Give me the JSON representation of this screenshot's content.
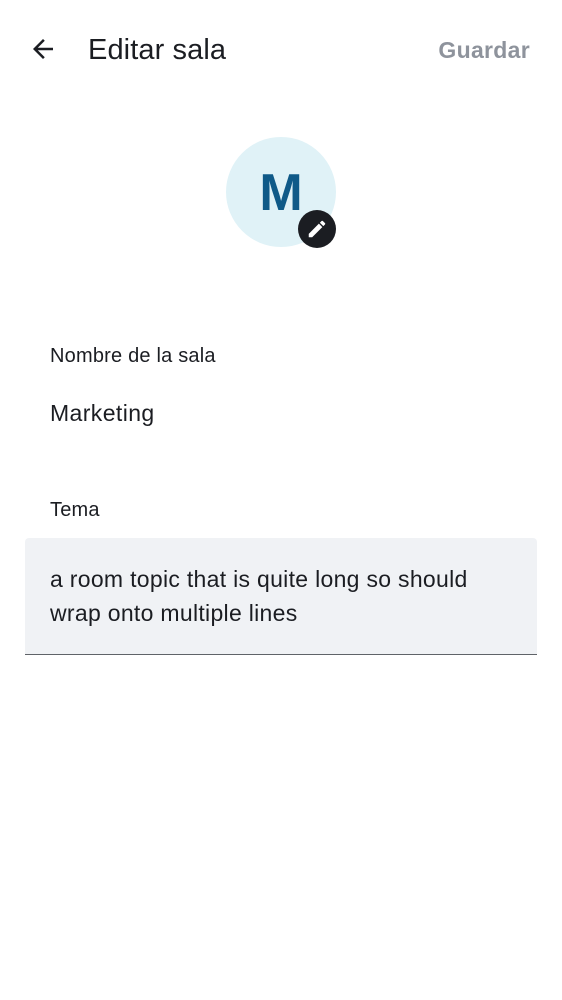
{
  "header": {
    "title": "Editar sala",
    "save_label": "Guardar",
    "back_icon": "arrow-left-icon"
  },
  "avatar": {
    "initial": "M",
    "edit_icon": "pencil-icon",
    "background_color": "#e0f2f7",
    "initial_color": "#0f5a88"
  },
  "form": {
    "name_label": "Nombre de la sala",
    "name_value": "Marketing",
    "topic_label": "Tema",
    "topic_value": "a room topic that is quite long so should wrap onto multiple lines"
  }
}
